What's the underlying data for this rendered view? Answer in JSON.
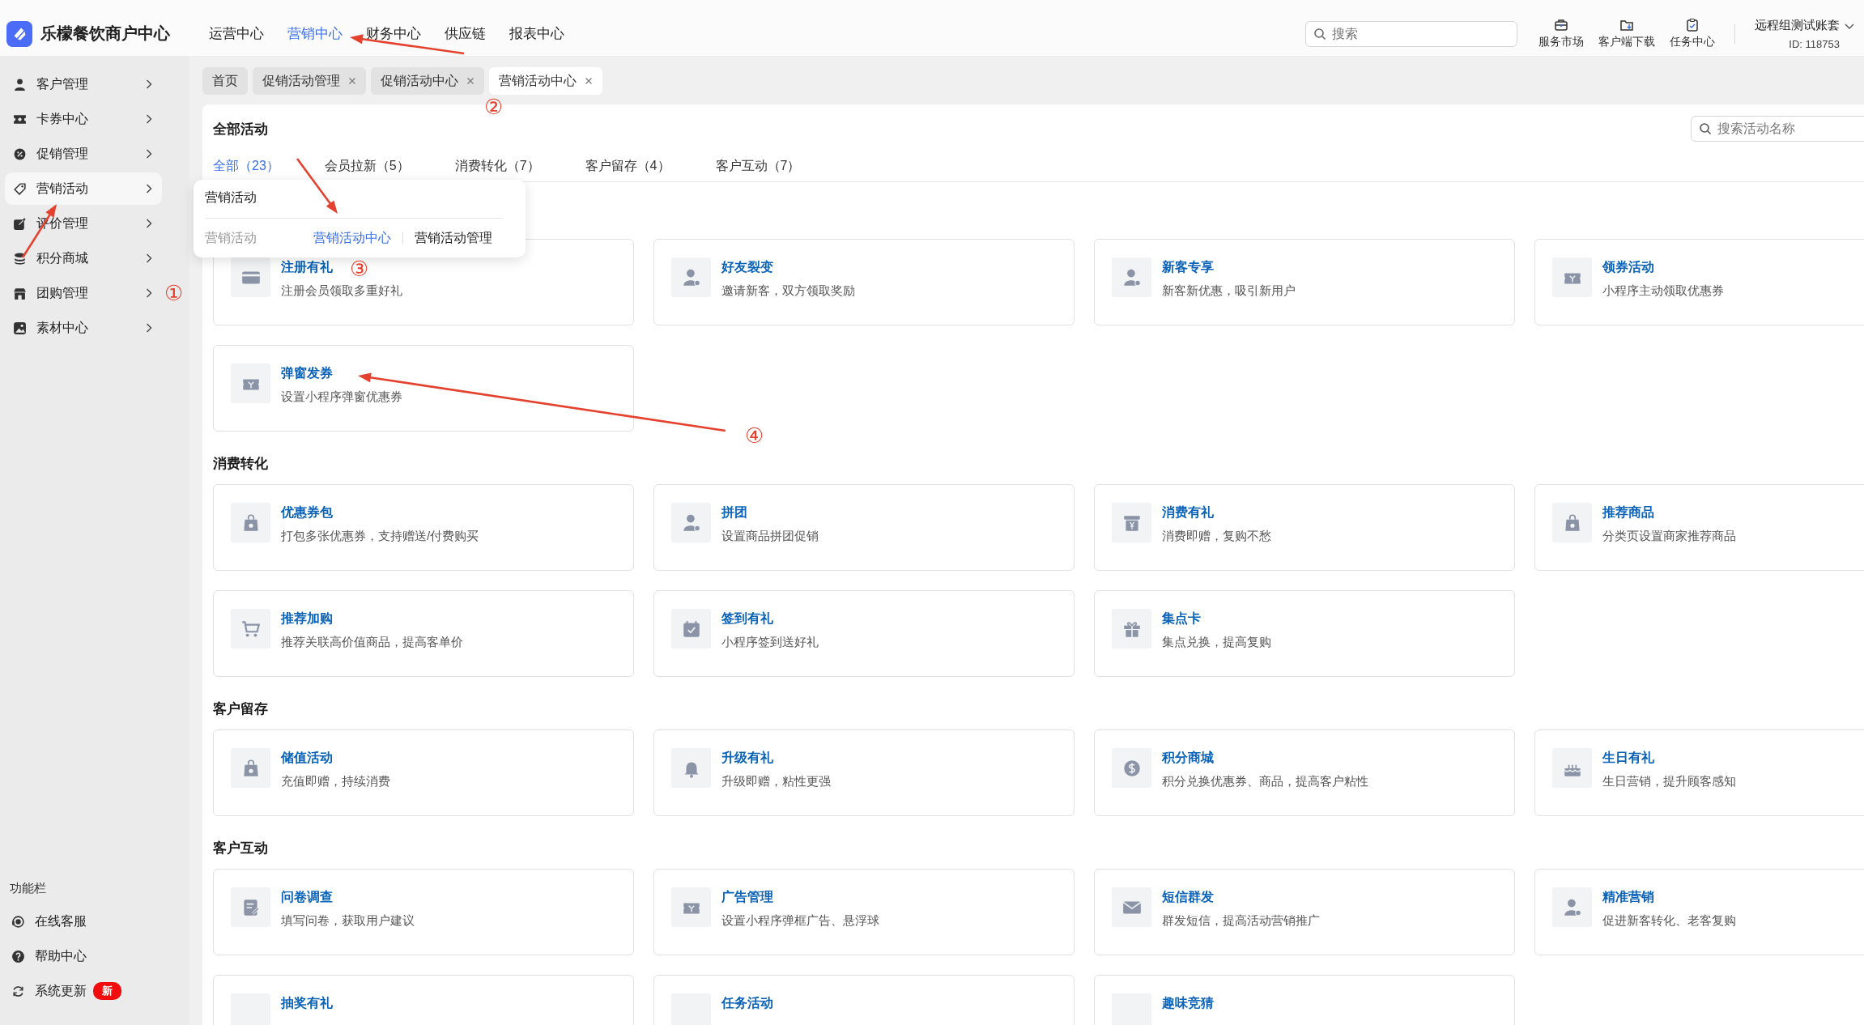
{
  "app": {
    "title": "乐檬餐饮商户中心"
  },
  "top_nav": [
    {
      "label": "运营中心",
      "selected": false
    },
    {
      "label": "营销中心",
      "selected": true
    },
    {
      "label": "财务中心",
      "selected": false
    },
    {
      "label": "供应链",
      "selected": false
    },
    {
      "label": "报表中心",
      "selected": false
    }
  ],
  "search": {
    "placeholder": "搜索"
  },
  "header_tools": [
    {
      "label": "服务市场"
    },
    {
      "label": "客户端下载"
    },
    {
      "label": "任务中心"
    }
  ],
  "account": {
    "name": "远程组测试账套",
    "id": "ID: 118753"
  },
  "sidebar": {
    "items": [
      {
        "label": "客户管理",
        "selected": false
      },
      {
        "label": "卡券中心",
        "selected": false
      },
      {
        "label": "促销管理",
        "selected": false
      },
      {
        "label": "营销活动",
        "selected": true
      },
      {
        "label": "评价管理",
        "selected": false
      },
      {
        "label": "积分商城",
        "selected": false
      },
      {
        "label": "团购管理",
        "selected": false
      },
      {
        "label": "素材中心",
        "selected": false
      }
    ],
    "footer_title": "功能栏",
    "footer_items": [
      {
        "label": "在线客服"
      },
      {
        "label": "帮助中心"
      },
      {
        "label": "系统更新",
        "badge": "新"
      }
    ]
  },
  "tabs": [
    {
      "label": "首页",
      "closable": false,
      "selected": false
    },
    {
      "label": "促销活动管理",
      "closable": true,
      "selected": false
    },
    {
      "label": "促销活动中心",
      "closable": true,
      "selected": false
    },
    {
      "label": "营销活动中心",
      "closable": true,
      "selected": true
    }
  ],
  "panel": {
    "title": "全部活动",
    "search_placeholder": "搜索活动名称",
    "filters": [
      {
        "label": "全部（23）",
        "selected": true
      },
      {
        "label": "会员拉新（5）",
        "selected": false
      },
      {
        "label": "消费转化（7）",
        "selected": false
      },
      {
        "label": "客户留存（4）",
        "selected": false
      },
      {
        "label": "客户互动（7）",
        "selected": false
      }
    ],
    "sections": [
      {
        "cards": [
          {
            "title": "注册有礼",
            "desc": "注册会员领取多重好礼"
          },
          {
            "title": "好友裂变",
            "desc": "邀请新客，双方领取奖励"
          },
          {
            "title": "新客专享",
            "desc": "新客新优惠，吸引新用户"
          },
          {
            "title": "领券活动",
            "desc": "小程序主动领取优惠券"
          },
          {
            "title": "弹窗发券",
            "desc": "设置小程序弹窗优惠券"
          }
        ]
      },
      {
        "title": "消费转化",
        "cards": [
          {
            "title": "优惠券包",
            "desc": "打包多张优惠券，支持赠送/付费购买"
          },
          {
            "title": "拼团",
            "desc": "设置商品拼团促销"
          },
          {
            "title": "消费有礼",
            "desc": "消费即赠，复购不愁"
          },
          {
            "title": "推荐商品",
            "desc": "分类页设置商家推荐商品"
          },
          {
            "title": "推荐加购",
            "desc": "推荐关联高价值商品，提高客单价"
          },
          {
            "title": "签到有礼",
            "desc": "小程序签到送好礼"
          },
          {
            "title": "集点卡",
            "desc": "集点兑换，提高复购"
          }
        ]
      },
      {
        "title": "客户留存",
        "cards": [
          {
            "title": "储值活动",
            "desc": "充值即赠，持续消费"
          },
          {
            "title": "升级有礼",
            "desc": "升级即赠，粘性更强"
          },
          {
            "title": "积分商城",
            "desc": "积分兑换优惠券、商品，提高客户粘性"
          },
          {
            "title": "生日有礼",
            "desc": "生日营销，提升顾客感知"
          }
        ]
      },
      {
        "title": "客户互动",
        "cards": [
          {
            "title": "问卷调查",
            "desc": "填写问卷，获取用户建议"
          },
          {
            "title": "广告管理",
            "desc": "设置小程序弹框广告、悬浮球"
          },
          {
            "title": "短信群发",
            "desc": "群发短信，提高活动营销推广"
          },
          {
            "title": "精准营销",
            "desc": "促进新客转化、老客复购"
          },
          {
            "title": "抽奖有礼"
          },
          {
            "title": "任务活动"
          },
          {
            "title": "趣味竞猜"
          }
        ]
      }
    ]
  },
  "popup": {
    "title": "营销活动",
    "group": "营销活动",
    "links": [
      {
        "label": "营销活动中心",
        "selected": true
      },
      {
        "label": "营销活动管理",
        "selected": false
      }
    ]
  },
  "annotations": [
    {
      "label": "①"
    },
    {
      "label": "②"
    },
    {
      "label": "③"
    },
    {
      "label": "④"
    }
  ]
}
